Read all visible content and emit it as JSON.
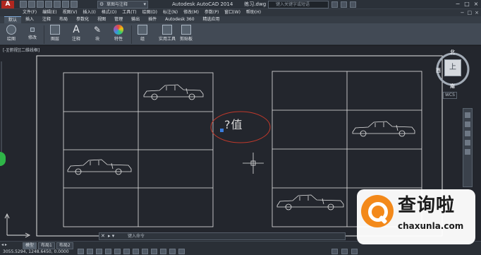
{
  "app": {
    "logo_letter": "A",
    "workspace": "草图与注释",
    "title": "Autodesk AutoCAD 2014",
    "filename": "练习.dwg",
    "search_placeholder": "键入关键字或短语",
    "window_controls": [
      "−",
      "□",
      "×"
    ]
  },
  "menu": {
    "items": [
      "文件(F)",
      "编辑(E)",
      "视图(V)",
      "插入(I)",
      "格式(O)",
      "工具(T)",
      "绘图(D)",
      "标注(N)",
      "修改(M)",
      "参数(P)",
      "窗口(W)",
      "帮助(H)"
    ],
    "right_controls": [
      "−",
      "□",
      "×"
    ]
  },
  "ribbon": {
    "tabs": [
      "默认",
      "插入",
      "注释",
      "布局",
      "参数化",
      "视图",
      "管理",
      "输出",
      "插件",
      "Autodesk 360",
      "精选应用"
    ],
    "active_tab": "默认",
    "tools": [
      "绘图",
      "修改",
      "图层",
      "注释",
      "块",
      "特性",
      "组",
      "实用工具",
      "剪贴板"
    ]
  },
  "viewport": {
    "label": "[-][俯视][二维线框]",
    "dimension_text": "?值",
    "viewcube": {
      "top": "北",
      "left": "西",
      "face": "上",
      "bottom": "南",
      "wcs": "WCS"
    }
  },
  "command_line": {
    "placeholder": "键入命令"
  },
  "layouts": {
    "tabs": [
      "模型",
      "布局1",
      "布局2"
    ],
    "active": "模型"
  },
  "status": {
    "coordinates": "3055.5294, 1248.6450, 0.0000"
  },
  "watermark": {
    "cn": "查询啦",
    "en": "chaxunla.com"
  },
  "colors": {
    "accent_orange": "#f3891a",
    "highlight_red": "#c0392b",
    "grip_blue": "#3b7ddd",
    "line_white": "#e6e6e6"
  }
}
